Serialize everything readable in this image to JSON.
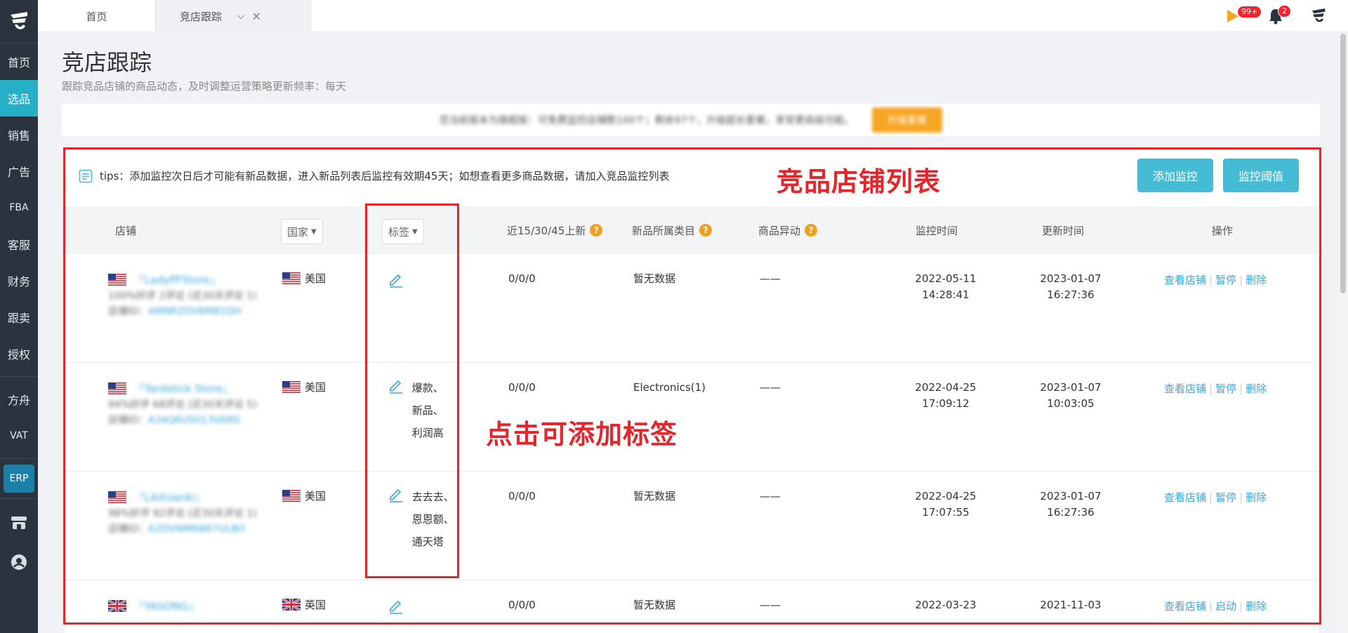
{
  "sidebar": {
    "items": [
      {
        "label": "首页",
        "active": false
      },
      {
        "label": "选品",
        "active": true
      },
      {
        "label": "销售",
        "active": false
      },
      {
        "label": "广告",
        "active": false
      },
      {
        "label": "FBA",
        "active": false
      },
      {
        "label": "客服",
        "active": false
      },
      {
        "label": "财务",
        "active": false
      },
      {
        "label": "跟卖",
        "active": false
      },
      {
        "label": "授权",
        "active": false
      }
    ],
    "items2": [
      {
        "label": "方舟"
      },
      {
        "label": "VAT"
      }
    ],
    "erp_label": "ERP"
  },
  "tabs": {
    "home": "首页",
    "active": "竞店跟踪"
  },
  "notifications": {
    "flag_badge": "99+",
    "bell_badge": "2"
  },
  "page": {
    "title": "竞店跟踪",
    "subtitle": "跟踪竞品店铺的商品动态，及时调整运营策略更新频率：每天"
  },
  "banner": {
    "text": "您当前版本为旗舰版：可免费监控店铺数100个；剩余97个，升级超长套餐，享受更高级功能。",
    "button": "升级套餐"
  },
  "tips": "tips：添加监控次日后才可能有新品数据，进入新品列表后监控有效期45天；如想查看更多商品数据，请加入竞品监控列表",
  "buttons": {
    "add": "添加监控",
    "threshold": "监控阈值"
  },
  "table": {
    "headers": {
      "store": "店铺",
      "country": "国家",
      "tags": "标签",
      "new": "近15/30/45上新",
      "category": "新品所属类目",
      "change": "商品异动",
      "monitor_time": "监控时间",
      "update_time": "更新时间",
      "actions": "操作"
    },
    "rows": [
      {
        "store_name": "『LadyPFStore』",
        "store_rating": "100%好评 2评论 (近30天评论 1)",
        "store_id_label": "店铺ID：",
        "store_id": "AMNRZOVBM81DH",
        "flag": "us",
        "country": "美国",
        "tags": [],
        "new": "0/0/0",
        "category": "暂无数据",
        "change": "——",
        "monitor_date": "2022-05-11",
        "monitor_time": "14:28:41",
        "update_date": "2023-01-07",
        "update_time": "16:27:36",
        "op1": "查看店铺",
        "op2": "暂停",
        "op3": "删除"
      },
      {
        "store_name": "『Yardstick Store』",
        "store_rating": "94%好评 68评论 (近30天评论 5)",
        "store_id_label": "店铺ID：",
        "store_id": "A34Q6U5013VARG",
        "flag": "us",
        "country": "美国",
        "tags": [
          "爆款、",
          "新品、",
          "利润高"
        ],
        "new": "0/0/0",
        "category": "Electronics(1)",
        "change": "——",
        "monitor_date": "2022-04-25",
        "monitor_time": "17:09:12",
        "update_date": "2023-01-07",
        "update_time": "10:03:05",
        "op1": "查看店铺",
        "op2": "暂停",
        "op3": "删除"
      },
      {
        "store_name": "『LAXUanki』",
        "store_rating": "98%好评 92评论 (近30天评论 1)",
        "store_id_label": "店铺ID：",
        "store_id": "A2DVWM6867ULBO",
        "flag": "us",
        "country": "美国",
        "tags": [
          "去去去、",
          "恩恩额、",
          "通天塔"
        ],
        "new": "0/0/0",
        "category": "暂无数据",
        "change": "——",
        "monitor_date": "2022-04-25",
        "monitor_time": "17:07:55",
        "update_date": "2023-01-07",
        "update_time": "16:27:36",
        "op1": "查看店铺",
        "op2": "暂停",
        "op3": "删除"
      },
      {
        "store_name": "『YASONG』",
        "flag": "uk",
        "country": "英国",
        "tags": [],
        "new": "0/0/0",
        "category": "暂无数据",
        "change": "——",
        "monitor_date": "2022-03-23",
        "update_date": "2021-11-03",
        "op1": "查看店铺",
        "op2": "启动",
        "op3": "删除"
      }
    ]
  },
  "annotations": {
    "list_label": "竞品店铺列表",
    "tag_label": "点击可添加标签"
  },
  "colors": {
    "sidebar_bg": "#2b333e",
    "accent": "#25b0c7",
    "link": "#3aa7d6",
    "annotation_red": "#e8242b"
  }
}
